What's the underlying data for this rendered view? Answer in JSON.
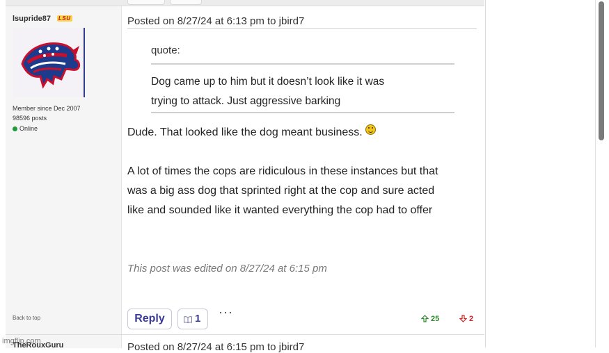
{
  "post": {
    "author": {
      "username": "lsupride87",
      "team_badge": "LSU",
      "member_since": "Member since Dec 2007",
      "post_count": "98596 posts",
      "status": "Online",
      "status_color": "#1f9a3d"
    },
    "header": "Posted on 8/27/24 at 6:13 pm to jbird7",
    "quote": {
      "label": "quote:",
      "lines": [
        "Dog came up to him but it doesn’t look like it was",
        "trying to attack. Just aggressive barking"
      ]
    },
    "body_lines": [
      "Dude. That looked like the dog meant business.",
      "A lot of times the cops are ridiculous in these instances but that",
      "was a big ass dog that sprinted right at the cop and sure acted",
      "like and sounded like it wanted everything the cop had to offer"
    ],
    "smiley_icon": "laughing-smiley-icon",
    "edited_note": "This post was edited on 8/27/24 at 6:15 pm",
    "back_to_top": "Back to top",
    "actions": {
      "reply_label": "Reply",
      "quote_count": "1",
      "more_label": "···",
      "upvotes": "25",
      "downvotes": "2",
      "upvote_color": "#2c8a2c",
      "downvote_color": "#d42020",
      "button_text_color": "#3a3a9a"
    }
  },
  "next_post": {
    "author": "TheRouxGuru",
    "header": "Posted on 8/27/24 at 6:15 pm to jbird7"
  },
  "watermark": "imgflip.com"
}
